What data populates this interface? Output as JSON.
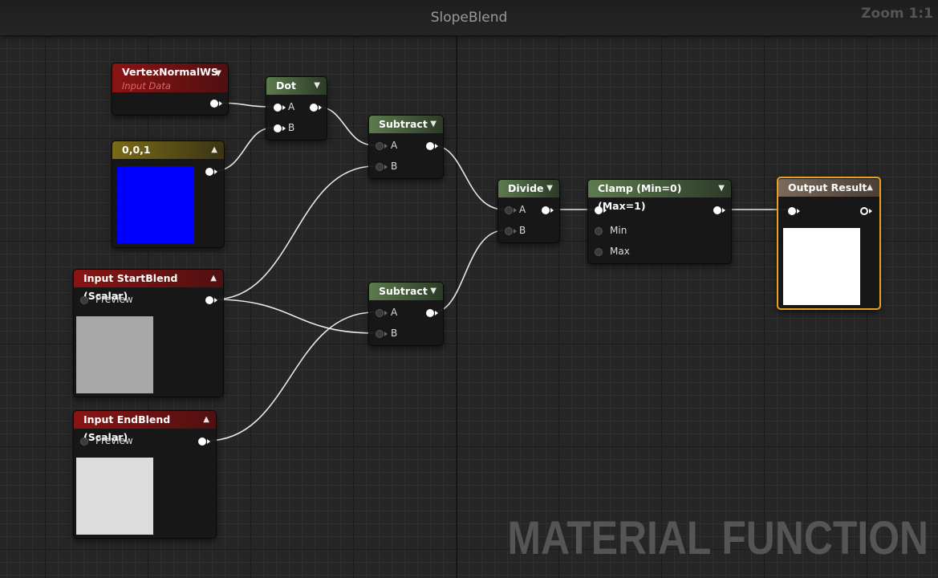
{
  "editor": {
    "title": "SlopeBlend",
    "zoom": "Zoom 1:1",
    "watermark": "MATERIAL FUNCTION"
  },
  "nodes": {
    "vertex_normal": {
      "title": "VertexNormalWS",
      "subtitle": "Input Data"
    },
    "constant": {
      "title": "0,0,1",
      "preview_color": "#0000ff"
    },
    "dot": {
      "title": "Dot",
      "pin_a": "A",
      "pin_b": "B"
    },
    "subtract1": {
      "title": "Subtract",
      "pin_a": "A",
      "pin_b": "B"
    },
    "subtract2": {
      "title": "Subtract",
      "pin_a": "A",
      "pin_b": "B"
    },
    "divide": {
      "title": "Divide",
      "pin_a": "A",
      "pin_b": "B"
    },
    "clamp": {
      "title": "Clamp (Min=0) (Max=1)",
      "pin_min": "Min",
      "pin_max": "Max"
    },
    "output": {
      "title": "Output Result",
      "preview_color": "#ffffff"
    },
    "start_blend": {
      "title": "Input StartBlend (Scalar)",
      "preview_label": "Preview",
      "preview_color": "#a8a8a8"
    },
    "end_blend": {
      "title": "Input EndBlend (Scalar)",
      "preview_label": "Preview",
      "preview_color": "#dcdcdc"
    }
  },
  "colors": {
    "input_header": "#8a1414",
    "math_header": "#5c7b4d",
    "constant_header": "#7a6a18",
    "output_header": "#7a6a5c",
    "selection": "#e8a020"
  }
}
